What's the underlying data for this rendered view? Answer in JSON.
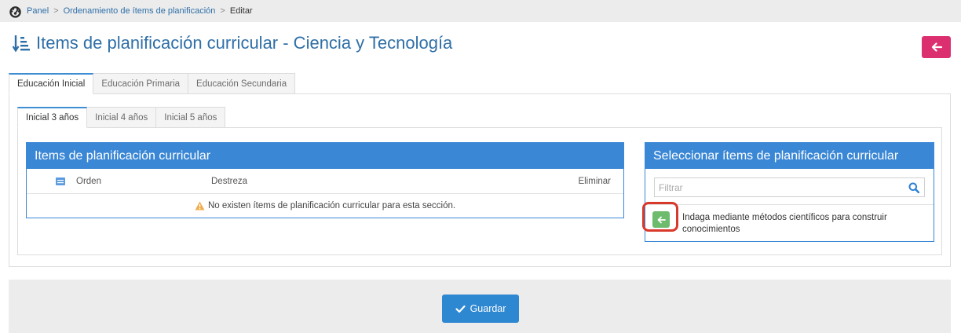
{
  "breadcrumb": {
    "home_icon": "dashboard-icon",
    "items": [
      "Panel",
      "Ordenamiento de ítems de planificación",
      "Editar"
    ],
    "separator": ">"
  },
  "page": {
    "title": "Items de planificación curricular - Ciencia y Tecnología",
    "title_icon": "sort-amount-icon",
    "back_icon": "arrow-left-icon"
  },
  "level_tabs": [
    "Educación Inicial",
    "Educación Primaria",
    "Educación Secundaria"
  ],
  "age_tabs": [
    "Inicial 3 años",
    "Inicial 4 años",
    "Inicial 5 años"
  ],
  "items_panel": {
    "title": "Items de planificación curricular",
    "columns": {
      "orden": "Orden",
      "destreza": "Destreza",
      "eliminar": "Eliminar"
    },
    "empty_message": "No existen ítems de planificación curricular para esta sección."
  },
  "select_panel": {
    "title": "Seleccionar ítems de planificación curricular",
    "filter_placeholder": "Filtrar",
    "filter_value": "",
    "items": [
      {
        "text": "Indaga mediante métodos científicos para construir conocimientos"
      }
    ]
  },
  "footer": {
    "save_label": "Guardar"
  },
  "colors": {
    "primary": "#3a87d5",
    "back_button": "#dc2f6f",
    "add_button": "#6dbb6d",
    "highlight": "#d9392b",
    "warning": "#f0ad4e"
  }
}
